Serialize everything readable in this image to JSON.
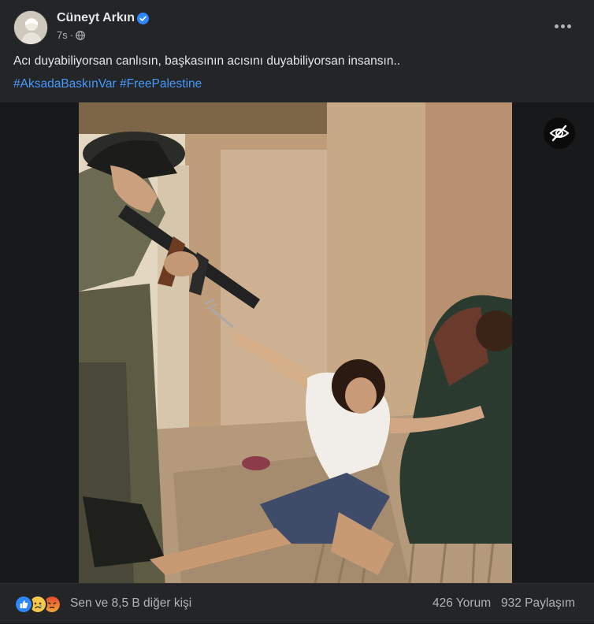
{
  "post": {
    "author": "Cüneyt Arkın",
    "time": "7s",
    "separator": "·",
    "text": "Acı duyabiliyorsan canlısın, başkasının acısını duyabiliyorsan insansın..",
    "hashtags": [
      "#AksadaBaskınVar",
      "#FreePalestine"
    ]
  },
  "icons": {
    "verified": "verified-badge-icon",
    "audience": "globe-icon",
    "more": "more-options-icon",
    "hide": "eye-slash-icon",
    "reactions": [
      "like-icon",
      "sad-icon",
      "angry-icon"
    ]
  },
  "footer": {
    "reactions_text": "Sen ve 8,5 B diğer kişi",
    "comments": "426 Yorum",
    "shares": "932 Paylaşım"
  },
  "colors": {
    "background": "#242526",
    "text_primary": "#e4e6eb",
    "text_secondary": "#b0b3b8",
    "link": "#4599ff",
    "verified": "#2d88ff"
  }
}
